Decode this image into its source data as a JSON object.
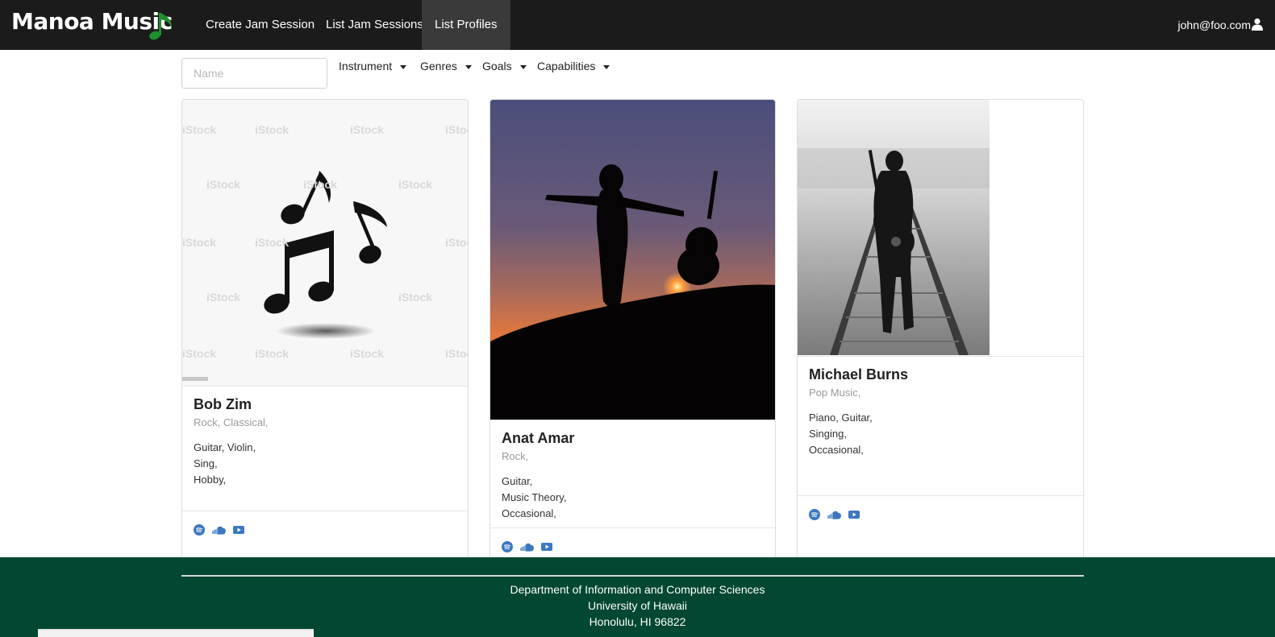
{
  "navbar": {
    "brand": "Manoa Music",
    "links": [
      "Create Jam Session",
      "List Jam Sessions",
      "List Profiles"
    ],
    "user": "john@foo.com",
    "colors": {
      "background": "#1b1b1b",
      "active": "#3a3a3a",
      "brand_note": "#1f8f2f"
    }
  },
  "filters": {
    "name_placeholder": "Name",
    "dropdowns": [
      "Instrument",
      "Genres",
      "Goals",
      "Capabilities"
    ]
  },
  "profiles": [
    {
      "name": "Bob Zim",
      "genres": "Rock, Classical,",
      "instruments": "Guitar, Violin,",
      "capabilities": "Sing,",
      "goals": "Hobby,",
      "image": "music-notes-stock-image"
    },
    {
      "name": "Anat Amar",
      "genres": "Rock,",
      "instruments": "Guitar,",
      "capabilities": "Music Theory,",
      "goals": "Occasional,",
      "image": "silhouette-guitar-sunset"
    },
    {
      "name": "Michael Burns",
      "genres": "Pop Music,",
      "instruments": "Piano, Guitar,",
      "capabilities": "Singing,",
      "goals": "Occasional,",
      "image": "guitarist-on-railway"
    }
  ],
  "social_icons": [
    "spotify-icon",
    "soundcloud-icon",
    "youtube-icon"
  ],
  "footer": {
    "lines": [
      "Department of Information and Computer Sciences",
      "University of Hawaii",
      "Honolulu, HI 96822"
    ],
    "background": "#024731"
  }
}
